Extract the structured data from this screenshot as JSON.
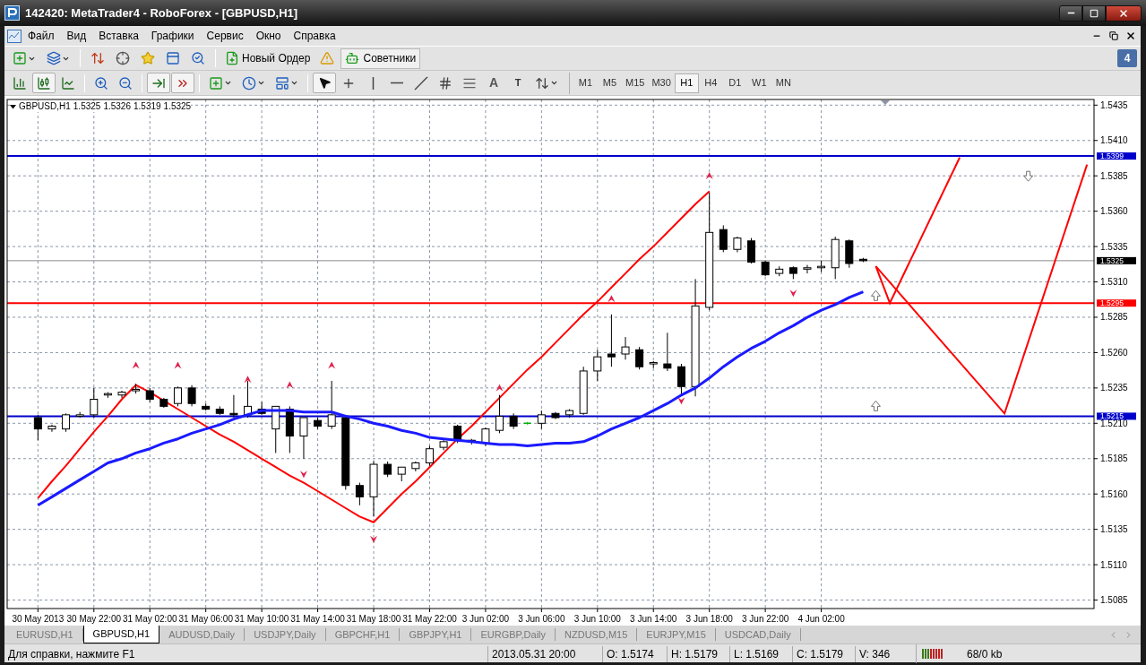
{
  "window": {
    "title": "142420: MetaTrader4 - RoboForex - [GBPUSD,H1]"
  },
  "menu": [
    {
      "label": "Файл"
    },
    {
      "label": "Вид"
    },
    {
      "label": "Вставка"
    },
    {
      "label": "Графики"
    },
    {
      "label": "Сервис"
    },
    {
      "label": "Окно"
    },
    {
      "label": "Справка"
    }
  ],
  "toolbar": {
    "order_button": {
      "label": "Новый Ордер"
    },
    "experts_button": {
      "label": "Советники",
      "on": true
    },
    "notifications": {
      "count": "4"
    }
  },
  "tools": [
    {
      "kind": "bars",
      "pressed": false
    },
    {
      "kind": "candles",
      "pressed": true
    },
    {
      "kind": "line",
      "pressed": false
    },
    {
      "kind": "zoom_in",
      "pressed": false
    },
    {
      "kind": "zoom_out",
      "pressed": false
    },
    {
      "kind": "autoscroll",
      "pressed": true
    },
    {
      "kind": "shift",
      "pressed": true
    },
    {
      "kind": "indicators",
      "pressed": false
    },
    {
      "kind": "periods",
      "pressed": false
    },
    {
      "kind": "templates",
      "pressed": false
    },
    {
      "kind": "cursor",
      "pressed": true
    },
    {
      "kind": "crosshair",
      "pressed": false
    },
    {
      "kind": "vline",
      "pressed": false
    },
    {
      "kind": "hline",
      "pressed": false
    },
    {
      "kind": "trendline",
      "pressed": false
    },
    {
      "kind": "channel",
      "pressed": false
    },
    {
      "kind": "fibo",
      "pressed": false
    },
    {
      "kind": "text",
      "label": "A",
      "pressed": false
    },
    {
      "kind": "label",
      "label": "T",
      "pressed": false
    },
    {
      "kind": "arrows",
      "pressed": false
    }
  ],
  "timeframes": [
    {
      "label": "M1",
      "selected": false
    },
    {
      "label": "M5",
      "selected": false
    },
    {
      "label": "M15",
      "selected": false
    },
    {
      "label": "M30",
      "selected": false
    },
    {
      "label": "H1",
      "selected": true
    },
    {
      "label": "H4",
      "selected": false
    },
    {
      "label": "D1",
      "selected": false
    },
    {
      "label": "W1",
      "selected": false
    },
    {
      "label": "MN",
      "selected": false
    }
  ],
  "chart": {
    "header": {
      "symbol": "GBPUSD,H1",
      "values": [
        "1.5325",
        "1.5326",
        "1.5319",
        "1.5325"
      ]
    },
    "chart_data": {
      "type": "candlestick",
      "grid": true,
      "ylim": [
        1.5079,
        1.5439
      ],
      "categories": [
        "30 May 2013",
        null,
        null,
        null,
        "30 May 22:00",
        null,
        null,
        null,
        "31 May 02:00",
        null,
        null,
        null,
        "31 May 06:00",
        null,
        null,
        null,
        "31 May 10:00",
        null,
        null,
        null,
        "31 May 14:00",
        null,
        null,
        null,
        "31 May 18:00",
        null,
        null,
        null,
        "31 May 22:00",
        null,
        null,
        null,
        "3 Jun 02:00",
        null,
        null,
        null,
        "3 Jun 06:00",
        null,
        null,
        null,
        "3 Jun 10:00",
        null,
        null,
        null,
        "3 Jun 14:00",
        null,
        null,
        null,
        "3 Jun 18:00",
        null,
        null,
        null,
        "3 Jun 22:00",
        null,
        null,
        null,
        "4 Jun 02:00",
        null,
        null,
        null,
        null,
        null,
        null,
        null,
        null,
        null,
        null,
        null,
        null,
        null,
        null,
        null,
        null,
        null,
        null,
        null
      ],
      "yticks": [
        {
          "value": 1.5435,
          "label": "1.5435"
        },
        {
          "value": 1.541,
          "label": "1.5410"
        },
        {
          "value": 1.5385,
          "label": "1.5385"
        },
        {
          "value": 1.536,
          "label": "1.5360"
        },
        {
          "value": 1.5335,
          "label": "1.5335"
        },
        {
          "value": 1.531,
          "label": "1.5310"
        },
        {
          "value": 1.5285,
          "label": "1.5285"
        },
        {
          "value": 1.526,
          "label": "1.5260"
        },
        {
          "value": 1.5235,
          "label": "1.5235"
        },
        {
          "value": 1.521,
          "label": "1.5210"
        },
        {
          "value": 1.5185,
          "label": "1.5185"
        },
        {
          "value": 1.516,
          "label": "1.5160"
        },
        {
          "value": 1.5135,
          "label": "1.5135"
        },
        {
          "value": 1.511,
          "label": "1.5110"
        },
        {
          "value": 1.5085,
          "label": "1.5085"
        }
      ],
      "ohlc": [
        [
          1.5214,
          1.5216,
          1.5198,
          1.5206
        ],
        [
          1.5206,
          1.5209,
          1.5204,
          1.5208
        ],
        [
          1.5206,
          1.5217,
          1.5204,
          1.5216
        ],
        [
          1.5215,
          1.5218,
          1.5214,
          1.5216
        ],
        [
          1.5216,
          1.5235,
          1.5214,
          1.5227
        ],
        [
          1.523,
          1.5232,
          1.5228,
          1.5231
        ],
        [
          1.523,
          1.5233,
          1.5228,
          1.5232
        ],
        [
          1.5233,
          1.5238,
          1.5231,
          1.5234
        ],
        [
          1.5233,
          1.5235,
          1.5225,
          1.5227
        ],
        [
          1.5227,
          1.5228,
          1.5221,
          1.5222
        ],
        [
          1.5224,
          1.5236,
          1.5222,
          1.5235
        ],
        [
          1.5235,
          1.5237,
          1.5222,
          1.5224
        ],
        [
          1.5222,
          1.5224,
          1.5219,
          1.522
        ],
        [
          1.522,
          1.5222,
          1.5216,
          1.5217
        ],
        [
          1.5217,
          1.523,
          1.5214,
          1.5216
        ],
        [
          1.5216,
          1.524,
          1.5214,
          1.5222
        ],
        [
          1.522,
          1.5225,
          1.5216,
          1.5217
        ],
        [
          1.5206,
          1.5222,
          1.5189,
          1.5222
        ],
        [
          1.522,
          1.5222,
          1.5189,
          1.5201
        ],
        [
          1.5201,
          1.5214,
          1.5185,
          1.5214
        ],
        [
          1.5212,
          1.5214,
          1.5206,
          1.5208
        ],
        [
          1.5208,
          1.524,
          1.5206,
          1.5216
        ],
        [
          1.5214,
          1.5216,
          1.5163,
          1.5166
        ],
        [
          1.5166,
          1.5168,
          1.5152,
          1.5158
        ],
        [
          1.5158,
          1.5183,
          1.5144,
          1.5181
        ],
        [
          1.5181,
          1.5183,
          1.5172,
          1.5174
        ],
        [
          1.5174,
          1.5179,
          1.5169,
          1.5179
        ],
        [
          1.5178,
          1.5183,
          1.5176,
          1.5182
        ],
        [
          1.5182,
          1.5194,
          1.518,
          1.5192
        ],
        [
          1.5193,
          1.5198,
          1.5191,
          1.5197
        ],
        [
          1.5208,
          1.5209,
          1.5196,
          1.5198
        ],
        [
          1.5198,
          1.5199,
          1.5195,
          1.5197
        ],
        [
          1.5196,
          1.5207,
          1.5194,
          1.5206
        ],
        [
          1.5205,
          1.523,
          1.5203,
          1.5215
        ],
        [
          1.5215,
          1.5217,
          1.5206,
          1.5208
        ],
        [
          1.521,
          1.5211,
          1.5209,
          1.521
        ],
        [
          1.521,
          1.5219,
          1.5206,
          1.5216
        ],
        [
          1.5217,
          1.5218,
          1.5213,
          1.5214
        ],
        [
          1.5216,
          1.522,
          1.5214,
          1.5219
        ],
        [
          1.5217,
          1.525,
          1.5216,
          1.5247
        ],
        [
          1.5247,
          1.5262,
          1.524,
          1.5257
        ],
        [
          1.5259,
          1.5287,
          1.525,
          1.5257
        ],
        [
          1.5259,
          1.5271,
          1.5255,
          1.5264
        ],
        [
          1.5262,
          1.5264,
          1.5248,
          1.525
        ],
        [
          1.5252,
          1.5254,
          1.5249,
          1.5253
        ],
        [
          1.5252,
          1.5274,
          1.5247,
          1.5249
        ],
        [
          1.525,
          1.5252,
          1.523,
          1.5236
        ],
        [
          1.5236,
          1.5312,
          1.5229,
          1.5293
        ],
        [
          1.5292,
          1.5373,
          1.529,
          1.5345
        ],
        [
          1.5347,
          1.535,
          1.5331,
          1.5333
        ],
        [
          1.5333,
          1.5342,
          1.5331,
          1.5341
        ],
        [
          1.5339,
          1.5341,
          1.5323,
          1.5324
        ],
        [
          1.5324,
          1.5325,
          1.5314,
          1.5315
        ],
        [
          1.5316,
          1.5321,
          1.5314,
          1.5319
        ],
        [
          1.532,
          1.5321,
          1.5312,
          1.5316
        ],
        [
          1.5319,
          1.5322,
          1.5316,
          1.532
        ],
        [
          1.532,
          1.5325,
          1.5317,
          1.5321
        ],
        [
          1.532,
          1.5342,
          1.5312,
          1.534
        ],
        [
          1.5339,
          1.534,
          1.532,
          1.5323
        ],
        [
          1.5326,
          1.5327,
          1.5324,
          1.5325
        ],
        null,
        null,
        null,
        null,
        null,
        null,
        null,
        null,
        null,
        null,
        null,
        null,
        null,
        null,
        null,
        null
      ],
      "series": [
        {
          "type": "line",
          "color": "#1a1aff",
          "values": [
            1.5152,
            1.5158,
            1.5164,
            1.517,
            1.5176,
            1.5182,
            1.5185,
            1.5189,
            1.5192,
            1.5196,
            1.5199,
            1.5203,
            1.5206,
            1.5209,
            1.5213,
            1.5216,
            1.5219,
            1.5219,
            1.5219,
            1.5218,
            1.5218,
            1.5218,
            1.5215,
            1.5213,
            1.521,
            1.5208,
            1.5205,
            1.5203,
            1.52,
            1.5199,
            1.5198,
            1.5197,
            1.5196,
            1.5195,
            1.5195,
            1.5194,
            1.5195,
            1.5196,
            1.5196,
            1.5197,
            1.5201,
            1.5206,
            1.521,
            1.5214,
            1.5219,
            1.5224,
            1.523,
            1.5235,
            1.5242,
            1.525,
            1.5257,
            1.5263,
            1.5268,
            1.5274,
            1.5279,
            1.5285,
            1.529,
            1.5294,
            1.5299,
            1.5303,
            null,
            null,
            null,
            null,
            null,
            null,
            null,
            null,
            null,
            null,
            null,
            null,
            null,
            null,
            null,
            null
          ]
        },
        {
          "type": "line",
          "color": "#ff0000",
          "values": [
            1.5157,
            1.5169,
            1.518,
            1.5192,
            1.5204,
            1.5215,
            1.5227,
            1.5237,
            1.5232,
            1.5226,
            1.522,
            1.5214,
            1.5208,
            1.5202,
            1.5197,
            1.5191,
            1.5185,
            1.5179,
            1.5173,
            1.5168,
            1.5162,
            1.5156,
            1.515,
            1.5144,
            1.514,
            1.515,
            1.516,
            1.5169,
            1.5179,
            1.5189,
            1.5199,
            1.5208,
            1.5218,
            1.5228,
            1.5238,
            1.5248,
            1.5257,
            1.5267,
            1.5277,
            1.5287,
            1.5296,
            1.5306,
            1.5316,
            1.5326,
            1.5335,
            1.5345,
            1.5355,
            1.5365,
            1.5374,
            null,
            null,
            null,
            null,
            null,
            null,
            null,
            null,
            null,
            null,
            null,
            null,
            null,
            null,
            null,
            null,
            null,
            null,
            null,
            null,
            null,
            null,
            null,
            null,
            null,
            null,
            null
          ]
        }
      ],
      "ref_lines": [
        {
          "axis": "y",
          "value": 1.5399,
          "label": "1.5399",
          "color": "#0000cc"
        },
        {
          "axis": "y",
          "value": 1.5325,
          "label": "1.5325",
          "color": "#8c8c8c"
        },
        {
          "axis": "y",
          "value": 1.5295,
          "label": "1.5295",
          "color": "#ff0000"
        },
        {
          "axis": "y",
          "value": 1.5215,
          "label": "1.5215",
          "color": "#0000cc"
        }
      ]
    }
  },
  "chart_tabs": [
    {
      "label": "EURUSD,H1",
      "selected": false
    },
    {
      "label": "GBPUSD,H1",
      "selected": true
    },
    {
      "label": "AUDUSD,Daily",
      "selected": false
    },
    {
      "label": "USDJPY,Daily",
      "selected": false
    },
    {
      "label": "GBPCHF,H1",
      "selected": false
    },
    {
      "label": "GBPJPY,H1",
      "selected": false
    },
    {
      "label": "EURGBP,Daily",
      "selected": false
    },
    {
      "label": "NZDUSD,M15",
      "selected": false
    },
    {
      "label": "EURJPY,M15",
      "selected": false
    },
    {
      "label": "USDCAD,Daily",
      "selected": false
    }
  ],
  "status_bar": {
    "help": "Для справки, нажмите F1",
    "time": "2013.05.31 20:00",
    "open": "O: 1.5174",
    "high": "H: 1.5179",
    "low": "L: 1.5169",
    "close": "C: 1.5179",
    "volume": "V: 346",
    "traffic": "68/0 kb"
  }
}
